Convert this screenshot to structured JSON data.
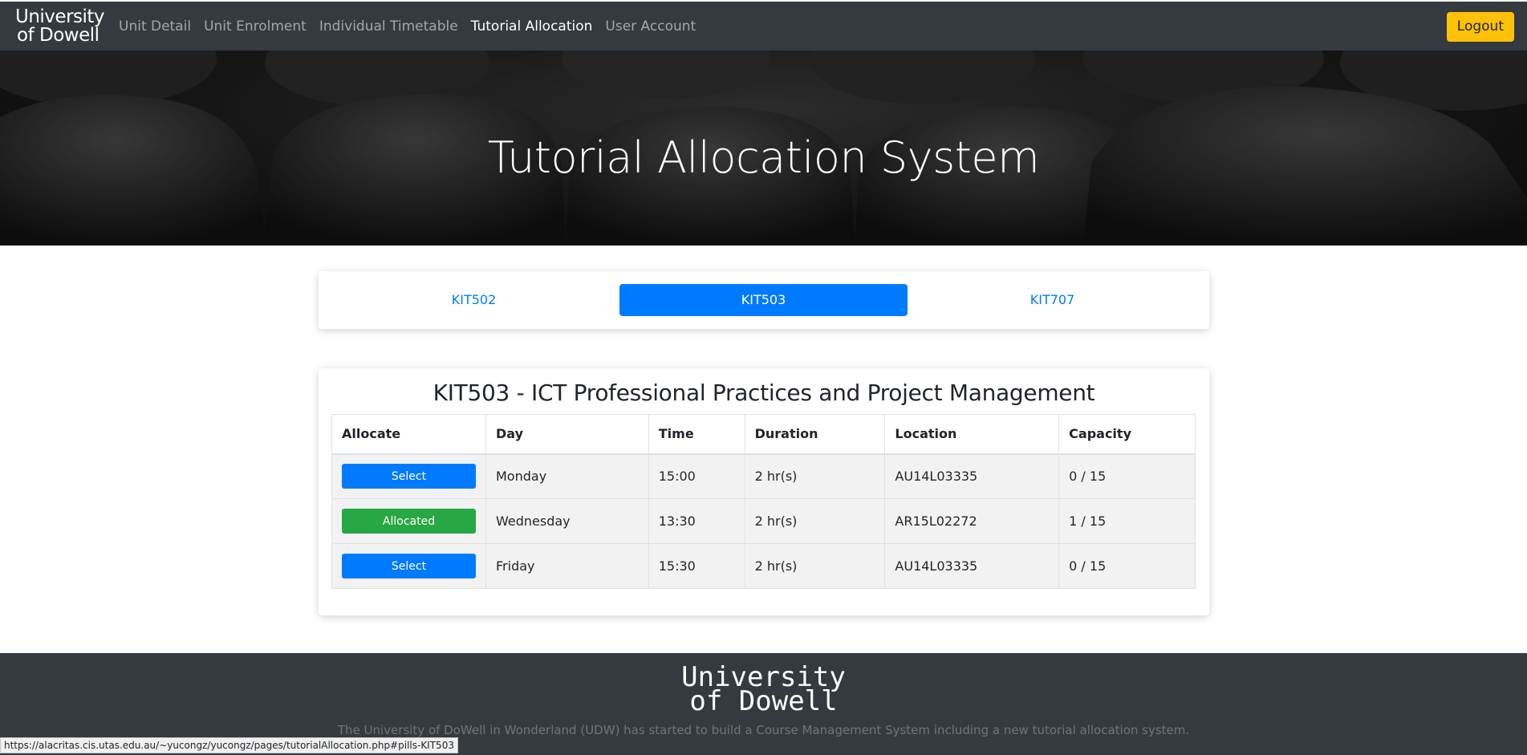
{
  "navbar": {
    "brand_line1": "University",
    "brand_line2": "of Dowell",
    "links": [
      {
        "label": "Unit Detail",
        "active": false
      },
      {
        "label": "Unit Enrolment",
        "active": false
      },
      {
        "label": "Individual Timetable",
        "active": false
      },
      {
        "label": "Tutorial Allocation",
        "active": true
      },
      {
        "label": "User Account",
        "active": false
      }
    ],
    "logout_label": "Logout"
  },
  "hero": {
    "title": "Tutorial Allocation System"
  },
  "pills": [
    {
      "label": "KIT502",
      "active": false
    },
    {
      "label": "KIT503",
      "active": true
    },
    {
      "label": "KIT707",
      "active": false
    }
  ],
  "unit": {
    "title": "KIT503 - ICT Professional Practices and Project Management",
    "columns": [
      "Allocate",
      "Day",
      "Time",
      "Duration",
      "Location",
      "Capacity"
    ],
    "rows": [
      {
        "action": "Select",
        "status": "select",
        "day": "Monday",
        "time": "15:00",
        "duration": "2 hr(s)",
        "location": "AU14L03335",
        "capacity": "0 / 15"
      },
      {
        "action": "Allocated",
        "status": "allocated",
        "day": "Wednesday",
        "time": "13:30",
        "duration": "2 hr(s)",
        "location": "AR15L02272",
        "capacity": "1 / 15"
      },
      {
        "action": "Select",
        "status": "select",
        "day": "Friday",
        "time": "15:30",
        "duration": "2 hr(s)",
        "location": "AU14L03335",
        "capacity": "0 / 15"
      }
    ]
  },
  "footer": {
    "brand_line1": "University",
    "brand_line2": "of Dowell",
    "text": "The University of DoWell in Wonderland (UDW) has started to build a Course Management System including a new tutorial allocation system."
  },
  "status_url": "https://alacritas.cis.utas.edu.au/~yucongz/yucongz/pages/tutorialAllocation.php#pills-KIT503",
  "colors": {
    "navbar_bg": "#343a40",
    "primary": "#007bff",
    "success": "#28a745",
    "warning": "#ffc107"
  }
}
